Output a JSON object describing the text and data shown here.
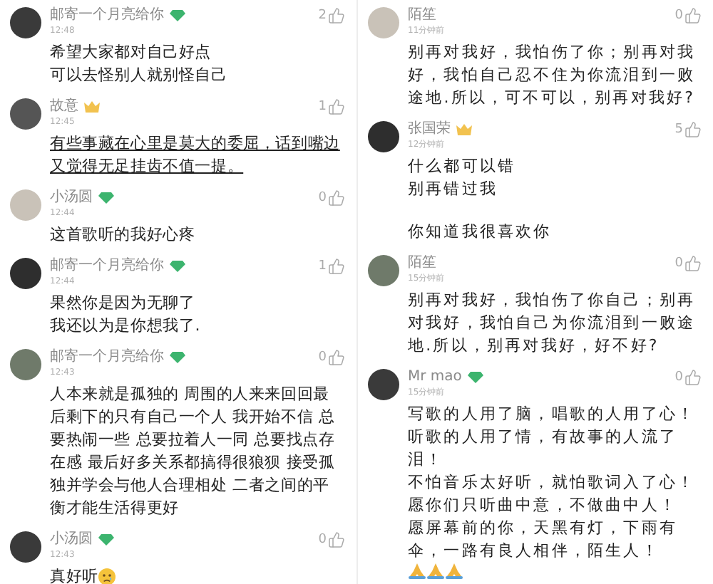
{
  "columns": [
    {
      "comments": [
        {
          "user": "邮寄一个月亮给你",
          "kind": "diamond",
          "time": "12:48",
          "likes": "2",
          "underlined": false,
          "paragraphs": [
            [
              "希望大家都对自己好点",
              "可以去怪别人就别怪自己"
            ]
          ]
        },
        {
          "user": "故意",
          "kind": "crown",
          "time": "12:45",
          "likes": "1",
          "underlined": true,
          "paragraphs": [
            [
              "有些事藏在心里是莫大的委屈，话到嘴边又觉得无足挂齿不值一提。"
            ]
          ]
        },
        {
          "user": "小汤圆",
          "kind": "diamond",
          "time": "12:44",
          "likes": "0",
          "underlined": false,
          "paragraphs": [
            [
              "这首歌听的我好心疼"
            ]
          ]
        },
        {
          "user": "邮寄一个月亮给你",
          "kind": "diamond",
          "time": "12:44",
          "likes": "1",
          "underlined": false,
          "paragraphs": [
            [
              "果然你是因为无聊了",
              "我还以为是你想我了."
            ]
          ]
        },
        {
          "user": "邮寄一个月亮给你",
          "kind": "diamond",
          "time": "12:43",
          "likes": "0",
          "underlined": false,
          "paragraphs": [
            [
              "人本来就是孤独的 周围的人来来回回最后剩下的只有自己一个人 我开始不信 总要热闹一些 总要拉着人一同 总要找点存在感 最后好多关系都搞得很狼狈 接受孤独并学会与他人合理相处 二者之间的平衡才能生活得更好"
            ]
          ]
        },
        {
          "user": "小汤圆",
          "kind": "diamond",
          "time": "12:43",
          "likes": "0",
          "underlined": false,
          "paragraphs": [
            [
              "真好听"
            ]
          ],
          "emojis": [
            {
              "kind": "sad"
            }
          ]
        }
      ]
    },
    {
      "comments": [
        {
          "user": "陌笙",
          "kind": "plain",
          "time": "11分钟前",
          "likes": "0",
          "underlined": false,
          "paragraphs": [
            [
              "别再对我好，我怕伤了你；别再对我好，我怕自己忍不住为你流泪到一败途地.所以，可不可以，别再对我好?"
            ]
          ]
        },
        {
          "user": "张国荣",
          "kind": "crown",
          "time": "12分钟前",
          "likes": "5",
          "underlined": false,
          "paragraphs": [
            [
              "什么都可以错",
              "别再错过我"
            ],
            [
              "你知道我很喜欢你"
            ]
          ]
        },
        {
          "user": "陌笙",
          "kind": "plain",
          "time": "15分钟前",
          "likes": "0",
          "underlined": false,
          "paragraphs": [
            [
              "别再对我好，我怕伤了你自己；别再对我好，我怕自己为你流泪到一败途地.所以，别再对我好，好不好?"
            ]
          ]
        },
        {
          "user": "Mr mao",
          "kind": "diamond",
          "time": "15分钟前",
          "likes": "0",
          "underlined": false,
          "paragraphs": [
            [
              "写歌的人用了脑，唱歌的人用了心！",
              "听歌的人用了情，有故事的人流了泪！",
              "不怕音乐太好听，就怕歌词入了心！",
              "愿你们只听曲中意，不做曲中人！",
              "愿屏幕前的你，天黑有灯，下雨有伞，一路有良人相伴，陌生人！"
            ]
          ],
          "emojis": [
            {
              "kind": "pray"
            },
            {
              "kind": "pray"
            },
            {
              "kind": "pray"
            }
          ]
        }
      ]
    }
  ]
}
